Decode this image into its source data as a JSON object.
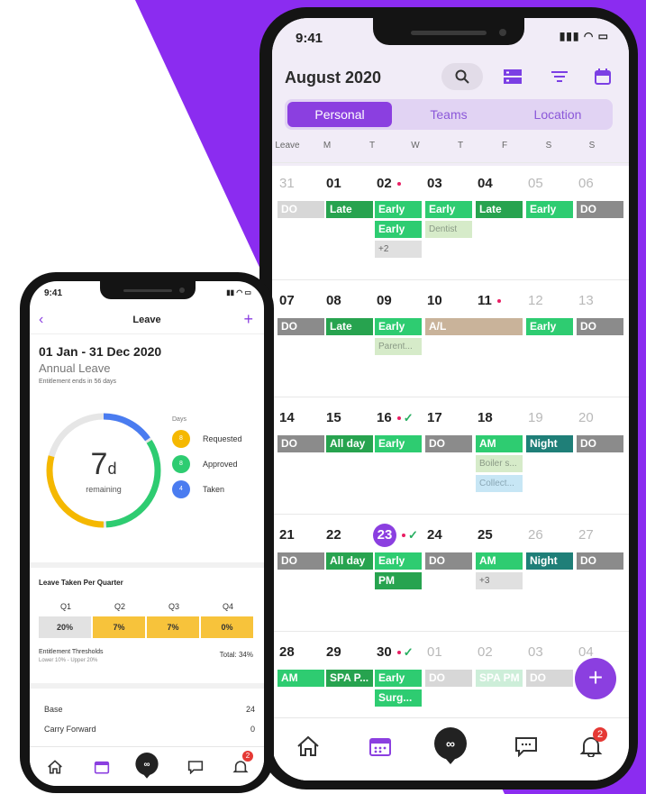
{
  "colors": {
    "accent": "#8b3fe0",
    "approved": "#2ecc71",
    "requested": "#f5b800",
    "taken": "#4a7cf0"
  },
  "calendar_phone": {
    "status_time": "9:41",
    "status_icons": "▮▮▮ ◠ ▭",
    "month": "August 2020",
    "tabs": [
      "Personal",
      "Teams",
      "Location"
    ],
    "dow": [
      "Leave",
      "M",
      "T",
      "W",
      "T",
      "F",
      "S",
      "S"
    ],
    "weeks": [
      {
        "days": [
          "31",
          "01",
          "02",
          "03",
          "04",
          "05",
          "06"
        ]
      },
      {
        "days": [
          "07",
          "08",
          "09",
          "10",
          "11",
          "12",
          "13"
        ]
      },
      {
        "days": [
          "14",
          "15",
          "16",
          "17",
          "18",
          "19",
          "20"
        ]
      },
      {
        "days": [
          "21",
          "22",
          "23",
          "24",
          "25",
          "26",
          "27"
        ]
      },
      {
        "days": [
          "28",
          "29",
          "30",
          "01",
          "02",
          "03",
          "04"
        ]
      }
    ],
    "chips": {
      "w1": [
        "DO",
        "Late",
        "Early",
        "Early",
        "Late",
        "Early",
        "DO",
        "Early",
        "+2",
        "Dentist"
      ],
      "w2": [
        "DO",
        "Late",
        "Early",
        "A/L",
        "Early",
        "DO",
        "Parent..."
      ],
      "w3": [
        "DO",
        "All day",
        "Early",
        "DO",
        "AM",
        "Night",
        "DO",
        "Boiler s...",
        "Collect..."
      ],
      "w4": [
        "DO",
        "All day",
        "Early",
        "DO",
        "AM",
        "Night",
        "DO",
        "PM",
        "+3"
      ],
      "w5": [
        "AM",
        "SPA P...",
        "Early",
        "DO",
        "SPA PM",
        "DO",
        "Surg..."
      ]
    },
    "fab": "+",
    "notif_count": "2"
  },
  "leave_phone": {
    "status_time": "9:41",
    "status_icons": "▮▮ ◠ ▭",
    "title": "Leave",
    "back": "‹",
    "add": "+",
    "period": "01 Jan - 31 Dec 2020",
    "leave_type": "Annual Leave",
    "entitlement_note": "Entitlement ends in 56 days",
    "remaining_value": "7",
    "remaining_unit": "d",
    "remaining_label": "remaining",
    "legend_header": "Days",
    "legend": [
      {
        "count": "8",
        "label": "Requested"
      },
      {
        "count": "8",
        "label": "Approved"
      },
      {
        "count": "4",
        "label": "Taken"
      }
    ],
    "donut_fractions": {
      "taken": 0.16,
      "approved": 0.34,
      "requested": 0.3
    },
    "quarter_title": "Leave Taken Per Quarter",
    "quarters": [
      "Q1",
      "Q2",
      "Q3",
      "Q4"
    ],
    "quarter_values": [
      "20%",
      "7%",
      "7%",
      "0%"
    ],
    "thresholds_label": "Entitlement Thresholds",
    "thresholds_range": "Lower 10% - Upper 20%",
    "total": "Total: 34%",
    "rows": [
      {
        "label": "Base",
        "value": "24"
      },
      {
        "label": "Carry Forward",
        "value": "0"
      }
    ],
    "notif_count": "2"
  }
}
